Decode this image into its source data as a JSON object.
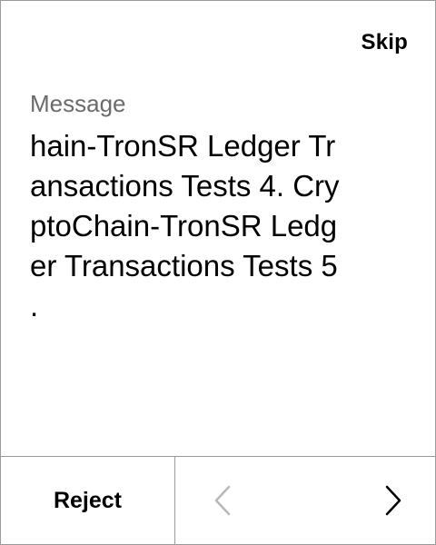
{
  "header": {
    "skip_label": "Skip"
  },
  "message": {
    "label": "Message",
    "lines": [
      "hain-TronSR Ledger Tr",
      "ansactions Tests 4. Cry",
      "ptoChain-TronSR Ledg",
      "er Transactions Tests 5",
      "."
    ]
  },
  "footer": {
    "reject_label": "Reject",
    "prev_icon": "chevron-left-icon",
    "next_icon": "chevron-right-icon",
    "prev_color": "#b8b8b8",
    "next_color": "#000000"
  }
}
